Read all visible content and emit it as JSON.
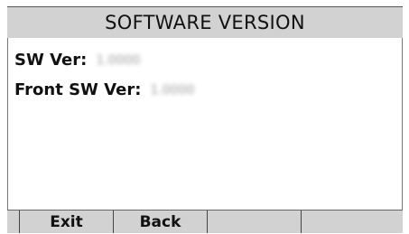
{
  "header": {
    "title": "SOFTWARE VERSION"
  },
  "info": {
    "sw_ver_label": "SW Ver:",
    "sw_ver_value": "1.0000",
    "front_sw_ver_label": "Front SW Ver:",
    "front_sw_ver_value": "1.0000"
  },
  "softkeys": [
    {
      "label": "Exit"
    },
    {
      "label": "Back"
    },
    {
      "label": ""
    },
    {
      "label": ""
    }
  ],
  "colors": {
    "bar_background": "#d2d2d2",
    "screen_background": "#ffffff",
    "text": "#111111"
  }
}
